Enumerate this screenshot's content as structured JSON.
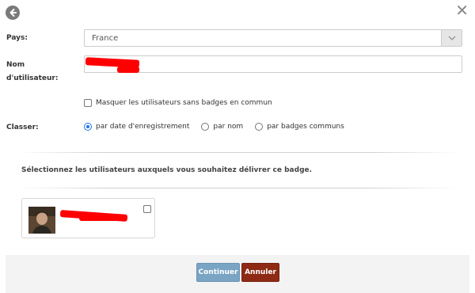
{
  "header": {
    "back_icon": "arrow-left-circle-icon",
    "close_symbol": "✕"
  },
  "form": {
    "country_label": "Pays:",
    "country_value": "France",
    "username_label_line1": "Nom",
    "username_label_line2": "d'utilisateur:",
    "username_value": "",
    "hide_users_label": "Masquer les utilisateurs sans badges en commun",
    "sort_label": "Classer:",
    "sort_options": [
      {
        "label": "par date d'enregistrement",
        "selected": true
      },
      {
        "label": "par nom",
        "selected": false
      },
      {
        "label": "par badges communs",
        "selected": false
      }
    ]
  },
  "instruction": "Sélectionnez les utilisateurs auxquels vous souhaitez délivrer ce badge.",
  "users": [
    {
      "name": "",
      "checked": false
    }
  ],
  "footer": {
    "continue_label": "Continuer",
    "cancel_label": "Annuler"
  },
  "colors": {
    "continue_button": "#7aa4c4",
    "cancel_button": "#8e2a14",
    "redaction": "#ff0000"
  }
}
